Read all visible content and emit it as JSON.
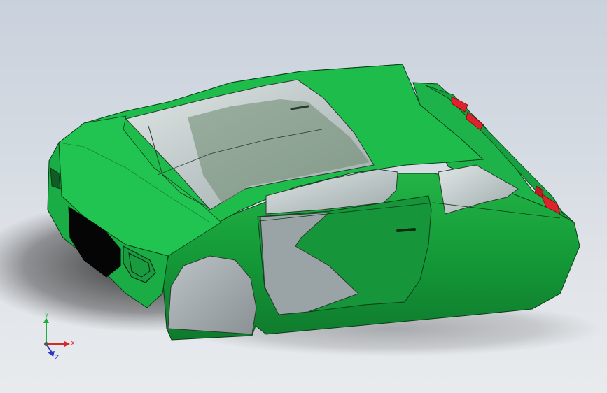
{
  "viewport": {
    "background_top": "#c9d1dc",
    "background_bottom": "#e8ebee"
  },
  "model": {
    "body_color": "#1dbb4a",
    "body_shadow_color": "#12803a",
    "glass_color": "#9aa6a8",
    "tail_light_color": "#e0212b"
  },
  "triad": {
    "y_label": "Y",
    "x_label": "X",
    "z_label": "Z",
    "y_color": "#1fae3a",
    "x_color": "#d62a2a",
    "z_color": "#2a36c8"
  }
}
